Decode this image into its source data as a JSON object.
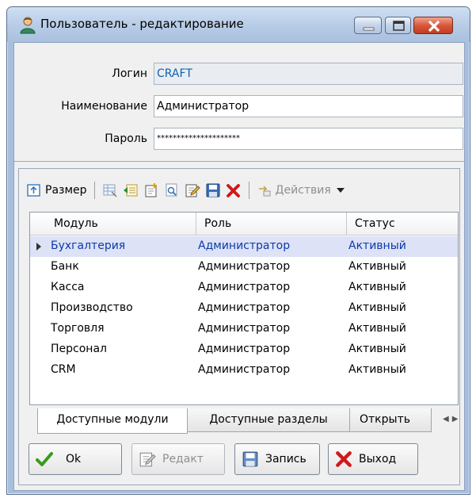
{
  "window": {
    "title": "Пользователь - редактирование"
  },
  "form": {
    "login_label": "Логин",
    "login_value": "CRAFT",
    "name_label": "Наименование",
    "name_value": "Администратор",
    "password_label": "Пароль",
    "password_value": "*********************"
  },
  "toolbar": {
    "size_label": "Размер",
    "actions_label": "Действия"
  },
  "table": {
    "columns": [
      "Модуль",
      "Роль",
      "Статус"
    ],
    "rows": [
      [
        "Бухгалтерия",
        "Администратор",
        "Активный"
      ],
      [
        "Банк",
        "Администратор",
        "Активный"
      ],
      [
        "Касса",
        "Администратор",
        "Активный"
      ],
      [
        "Производство",
        "Администратор",
        "Активный"
      ],
      [
        "Торговля",
        "Администратор",
        "Активный"
      ],
      [
        "Персонал",
        "Администратор",
        "Активный"
      ],
      [
        "CRM",
        "Администратор",
        "Активный"
      ]
    ],
    "selected_row": 0
  },
  "tabs": [
    "Доступные модули",
    "Доступные разделы",
    "Открыть"
  ],
  "buttons": {
    "ok": "Ok",
    "edit": "Редакт",
    "save": "Запись",
    "exit": "Выход"
  },
  "colors": {
    "selected_row": "#dde2f7",
    "selected_text": "#0b3aa8",
    "readonly_text": "#1060b0"
  }
}
